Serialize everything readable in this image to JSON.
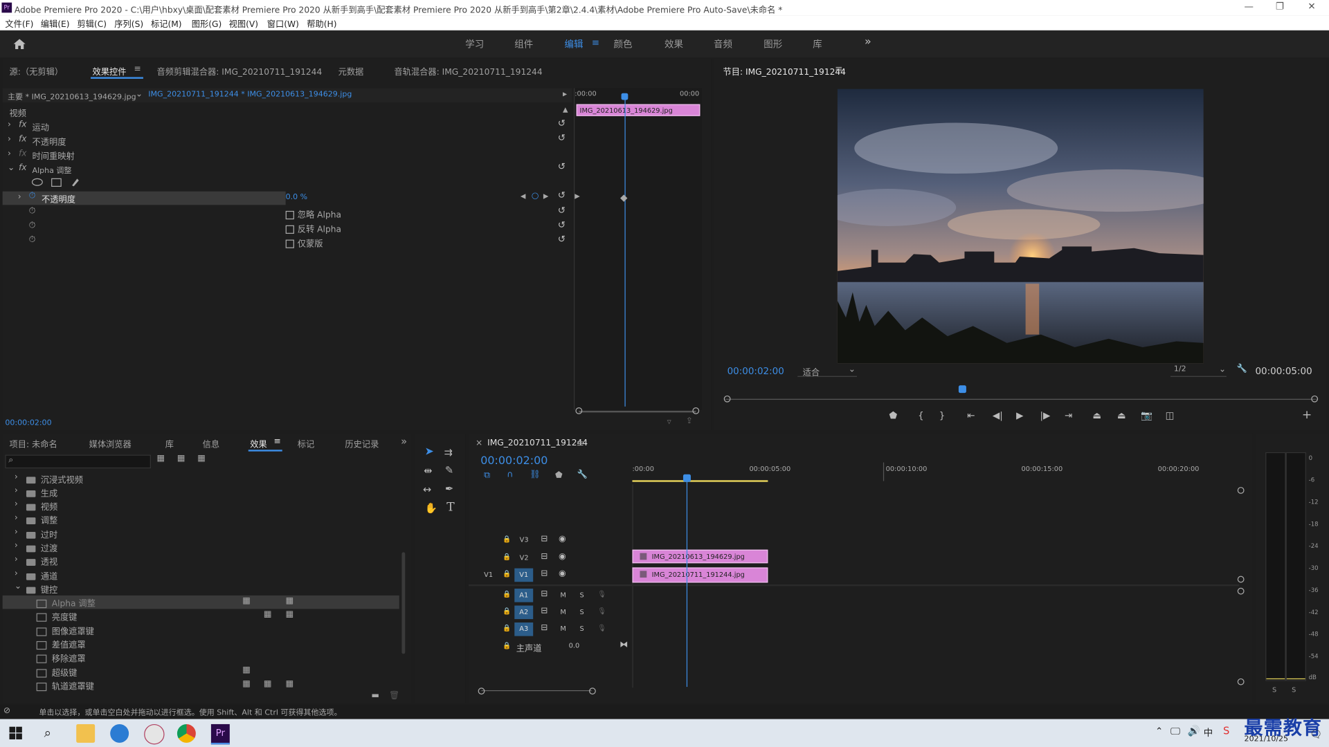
{
  "window": {
    "title": "Adobe Premiere Pro 2020 - C:\\用户\\hbxy\\桌面\\配套素材 Premiere Pro 2020 从新手到高手\\配套素材 Premiere Pro 2020 从新手到高手\\第2章\\2.4.4\\素材\\Adobe Premiere Pro Auto-Save\\未命名 *",
    "app_icon": "Pr"
  },
  "menu": [
    "文件(F)",
    "编辑(E)",
    "剪辑(C)",
    "序列(S)",
    "标记(M)",
    "图形(G)",
    "视图(V)",
    "窗口(W)",
    "帮助(H)"
  ],
  "workspaces": {
    "items": [
      "学习",
      "组件",
      "编辑",
      "颜色",
      "效果",
      "音频",
      "图形",
      "库"
    ],
    "active": "编辑",
    "overflow": "»"
  },
  "source_panel": {
    "tabs": [
      "源:（无剪辑）",
      "效果控件",
      "音频剪辑混合器: IMG_20210711_191244",
      "元数据",
      "音轨混合器: IMG_20210711_191244"
    ],
    "active_tab": "效果控件",
    "master_label": "主要 * IMG_20210613_194629.jpg",
    "sequence_label": "IMG_20210711_191244 * IMG_20210613_194629.jpg",
    "section_video": "视频",
    "effects": [
      {
        "name": "运动",
        "expanded": false
      },
      {
        "name": "不透明度",
        "expanded": false
      },
      {
        "name": "时间重映射",
        "expanded": false
      },
      {
        "name": "Alpha 调整",
        "expanded": true
      }
    ],
    "alpha_params": {
      "opacity_label": "不透明度",
      "opacity_value": "0.0 %",
      "ignore_alpha": "忽略 Alpha",
      "invert_alpha": "反转 Alpha",
      "mask_only": "仅蒙版"
    },
    "mini_tl": {
      "start": ":00:00",
      "end": "00:00",
      "clip_label": "IMG_20210613_194629.jpg"
    },
    "timecode": "00:00:02:00"
  },
  "program": {
    "title": "节目: IMG_20210711_191244",
    "timecode": "00:00:02:00",
    "fit": "适合",
    "resolution": "1/2",
    "duration": "00:00:05:00",
    "playhead_fraction": 0.4
  },
  "project": {
    "tabs": [
      "项目: 未命名",
      "媒体浏览器",
      "库",
      "信息",
      "效果",
      "标记",
      "历史记录"
    ],
    "active_tab": "效果",
    "folders": [
      "沉浸式视频",
      "生成",
      "视频",
      "调整",
      "过时",
      "过渡",
      "透视",
      "通道",
      "键控"
    ],
    "keying_items": [
      "Alpha 调整",
      "亮度键",
      "图像遮罩键",
      "差值遮罩",
      "移除遮罩",
      "超级键",
      "轨道遮罩键"
    ]
  },
  "timeline": {
    "sequence": "IMG_20210711_191244",
    "timecode": "00:00:02:00",
    "ruler": [
      ":00:00",
      "00:00:05:00",
      "00:00:10:00",
      "00:00:15:00",
      "00:00:20:00"
    ],
    "video_tracks": [
      "V3",
      "V2",
      "V1"
    ],
    "audio_tracks": [
      "A1",
      "A2",
      "A3"
    ],
    "source_patch": "V1",
    "master_label": "主声道",
    "master_value": "0.0",
    "clips": [
      {
        "track": "V2",
        "name": "IMG_20210613_194629.jpg"
      },
      {
        "track": "V1",
        "name": "IMG_20210711_191244.jpg"
      }
    ],
    "m_label": "M",
    "s_label": "S"
  },
  "meter": {
    "labels": [
      "0",
      "-6",
      "-12",
      "-18",
      "-24",
      "-30",
      "-36",
      "-42",
      "-48",
      "-54",
      "dB"
    ],
    "solo": [
      "S",
      "S"
    ]
  },
  "status": "单击以选择，或单击空白处并拖动以进行框选。使用 Shift、Alt 和 Ctrl 可获得其他选项。",
  "taskbar": {
    "date": "2021/10/25",
    "watermark": "最需教育"
  },
  "colors": {
    "accent": "#3d8ee6",
    "clip": "#d985d7",
    "panel_bg": "#1e1e1e"
  }
}
